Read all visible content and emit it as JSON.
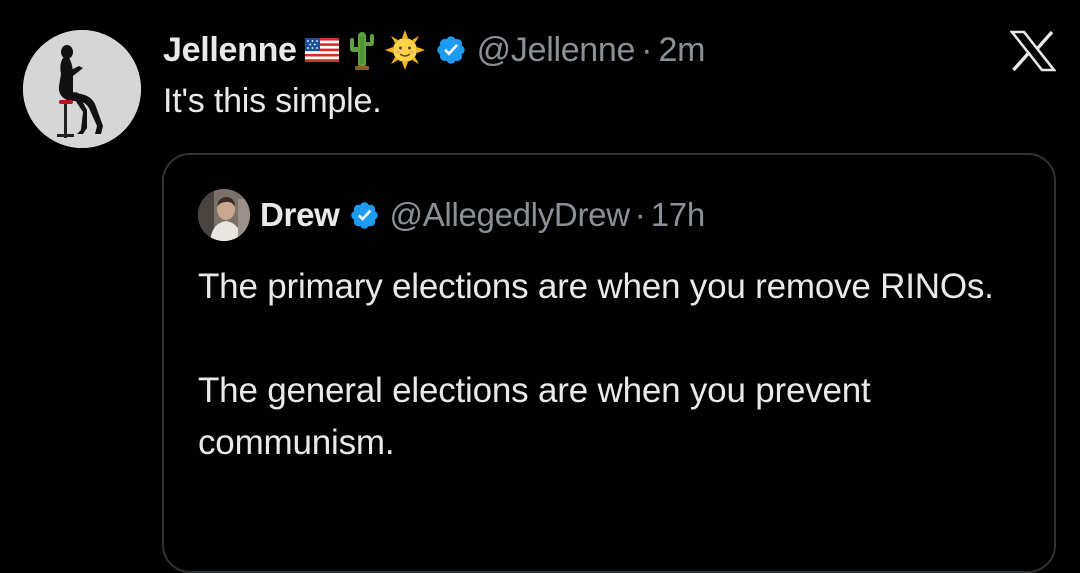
{
  "tweet": {
    "author": {
      "display_name": "Jellenne",
      "emojis": [
        "us-flag-icon",
        "cactus-icon",
        "sun-with-face-icon"
      ],
      "verified": true,
      "handle": "@Jellenne",
      "separator": "·",
      "time": "2m"
    },
    "text": "It's this simple.",
    "logo": "x-logo-icon"
  },
  "quote": {
    "author": {
      "display_name": "Drew",
      "verified": true,
      "handle": "@AllegedlyDrew",
      "separator": "·",
      "time": "17h"
    },
    "paragraphs": [
      "The primary elections are when you remove RINOs.",
      "The general elections are when you prevent communism."
    ]
  },
  "colors": {
    "background": "#000000",
    "text": "#e7e9ea",
    "secondary_text": "#8b9096",
    "verified_badge": "#1d9bf0",
    "quote_border": "#2f3336"
  }
}
